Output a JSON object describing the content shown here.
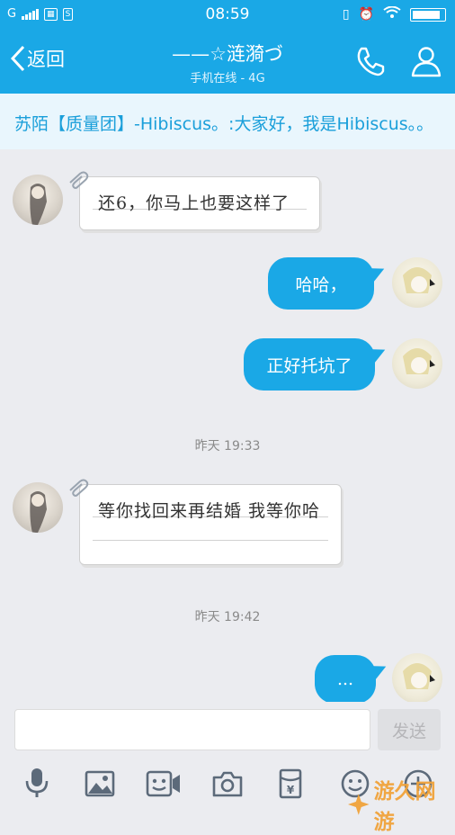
{
  "status_bar": {
    "carrier": "G",
    "time": "08:59"
  },
  "header": {
    "back_label": "返回",
    "title": "——☆涟漪づ",
    "subtitle": "手机在线 - 4G"
  },
  "notice": {
    "text": "苏陌【质量团】-Hibiscus。:大家好，我是Hibiscus。。"
  },
  "messages": [
    {
      "side": "in",
      "text": "还6，你马上也要这样了"
    },
    {
      "side": "out",
      "text": "哈哈，"
    },
    {
      "side": "out",
      "text": "正好托坑了"
    },
    {
      "timestamp": "昨天 19:33"
    },
    {
      "side": "in",
      "text": "等你找回来再结婚 我等你哈"
    },
    {
      "timestamp": "昨天 19:42"
    },
    {
      "side": "out",
      "text": "..."
    }
  ],
  "composer": {
    "input_value": "",
    "send_label": "发送"
  },
  "toolbar": {
    "icons": [
      "microphone-icon",
      "image-icon",
      "video-icon",
      "camera-icon",
      "red-packet-icon",
      "emoji-icon",
      "plus-icon"
    ]
  },
  "watermark": {
    "text": "游久网游"
  },
  "colors": {
    "brand": "#1aa8e6",
    "background": "#ebecf0",
    "notice_text": "#1a9fda"
  }
}
